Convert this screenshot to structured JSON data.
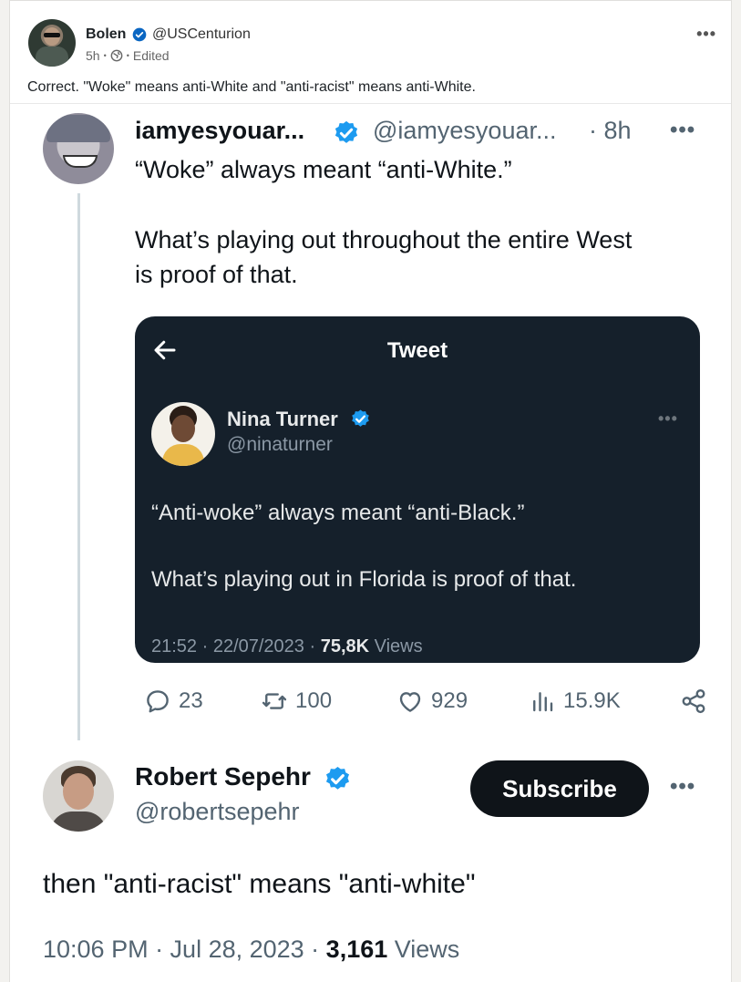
{
  "post": {
    "author_name": "Bolen",
    "author_handle": "@USCenturion",
    "time": "5h",
    "sep": "•",
    "edited": "Edited",
    "more": "•••",
    "text": "Correct. \"Woke\" means anti-White and \"anti-racist\" means anti-White."
  },
  "tweet": {
    "name": "iamyesyouar...",
    "handle": "@iamyesyouar...",
    "time": "· 8h",
    "more": "•••",
    "line1": "“Woke” always meant “anti-White.”",
    "line2": "What’s playing out throughout the entire West",
    "line3": "is proof of that."
  },
  "quoted": {
    "header": "Tweet",
    "name": "Nina Turner",
    "handle": "@ninaturner",
    "more": "•••",
    "text1": "“Anti-woke” always meant “anti-Black.”",
    "text2": "What’s playing out in Florida is proof of that.",
    "timestamp": "21:52 · 22/07/2023 · ",
    "views_count": "75,8K",
    "views_label": " Views"
  },
  "actions": {
    "replies": "23",
    "retweets": "100",
    "likes": "929",
    "views": "15.9K"
  },
  "reply": {
    "name": "Robert Sepehr",
    "handle": "@robertsepehr",
    "subscribe": "Subscribe",
    "more": "•••",
    "text": "then \"anti-racist\" means \"anti-white\"",
    "timestamp": "10:06 PM · Jul 28, 2023 · ",
    "views_count": "3,161",
    "views_label": " Views"
  },
  "colors": {
    "verified_blue": "#1d9bf0",
    "dark_bg": "#15202b",
    "muted": "#536471"
  }
}
